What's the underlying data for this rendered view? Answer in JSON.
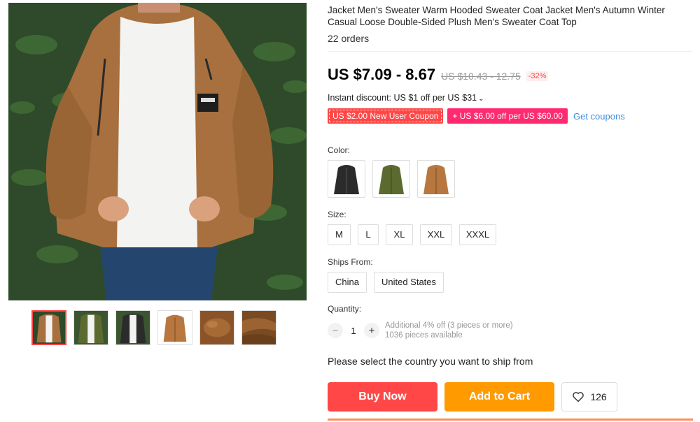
{
  "product": {
    "title": "Jacket Men's Sweater Warm Hooded Sweater Coat Jacket Men's Autumn Winter Casual Loose Double-Sided Plush Men's Sweater Coat Top",
    "orders": "22 orders"
  },
  "price": {
    "current": "US $7.09 - 8.67",
    "original": "US $10.43 - 12.75",
    "discount": "-32%"
  },
  "instant_discount": "Instant discount: US $1 off per US $31",
  "coupons": {
    "new_user": "US $2.00 New User Coupon",
    "store": "+ US $6.00 off per US $60.00",
    "get_link": "Get coupons"
  },
  "color": {
    "label": "Color:",
    "options": [
      {
        "name": "black",
        "hex": "#2b2b2b"
      },
      {
        "name": "army-green",
        "hex": "#5b6a2e"
      },
      {
        "name": "khaki",
        "hex": "#b7773e"
      }
    ]
  },
  "size": {
    "label": "Size:",
    "options": [
      "M",
      "L",
      "XL",
      "XXL",
      "XXXL"
    ]
  },
  "ships_from": {
    "label": "Ships From:",
    "options": [
      "China",
      "United States"
    ]
  },
  "quantity": {
    "label": "Quantity:",
    "minus": "−",
    "value": "1",
    "plus": "+",
    "note_line1": "Additional 4% off (3 pieces or more)",
    "note_line2": "1036 pieces available"
  },
  "ship_note": "Please select the country you want to ship from",
  "actions": {
    "buy_now": "Buy Now",
    "add_to_cart": "Add to Cart",
    "wishlist_count": "126"
  },
  "colors": {
    "accent_red": "#ff4747",
    "accent_orange": "#ff9a00",
    "coupon_pink": "#ff2a70",
    "link_blue": "#3c8ee0"
  }
}
